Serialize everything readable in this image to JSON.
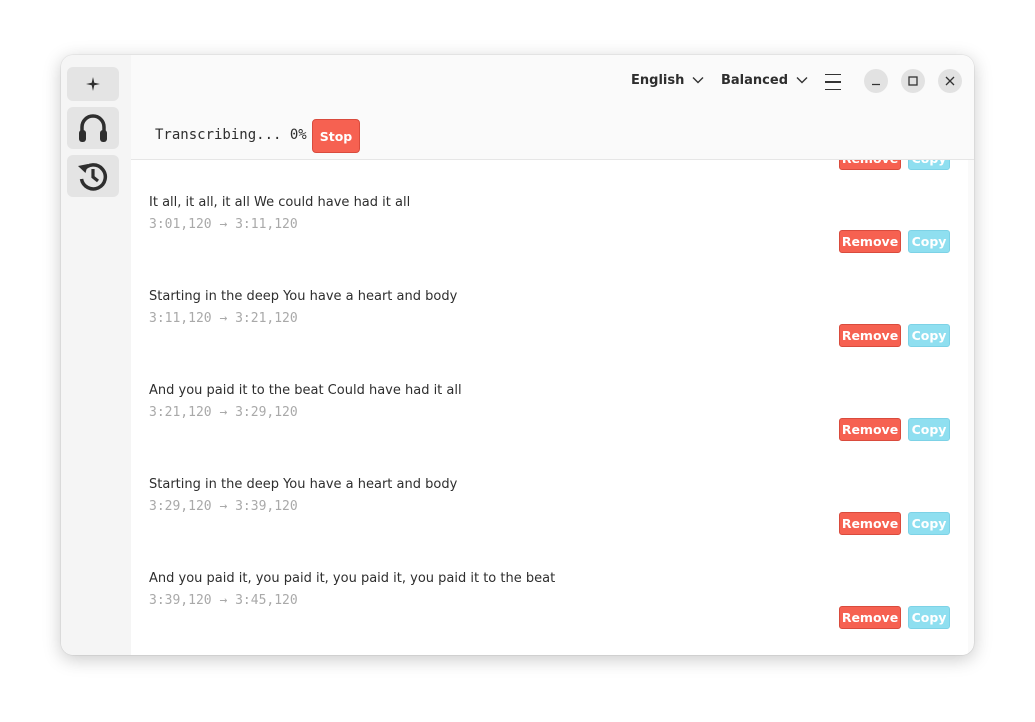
{
  "header": {
    "language": "English",
    "quality": "Balanced"
  },
  "status": {
    "text": "Transcribing... 0%",
    "stop_label": "Stop"
  },
  "buttons": {
    "remove": "Remove",
    "copy": "Copy"
  },
  "entries": [
    {
      "text": "It all, it all, it all We could have had it all",
      "time": "3:01,120 → 3:11,120"
    },
    {
      "text": "Starting in the deep You have a heart and body",
      "time": "3:11,120 → 3:21,120"
    },
    {
      "text": "And you paid it to the beat Could have had it all",
      "time": "3:21,120 → 3:29,120"
    },
    {
      "text": "Starting in the deep You have a heart and body",
      "time": "3:29,120 → 3:39,120"
    },
    {
      "text": "And you paid it, you paid it, you paid it, you paid it to the beat",
      "time": "3:39,120 → 3:45,120"
    }
  ]
}
